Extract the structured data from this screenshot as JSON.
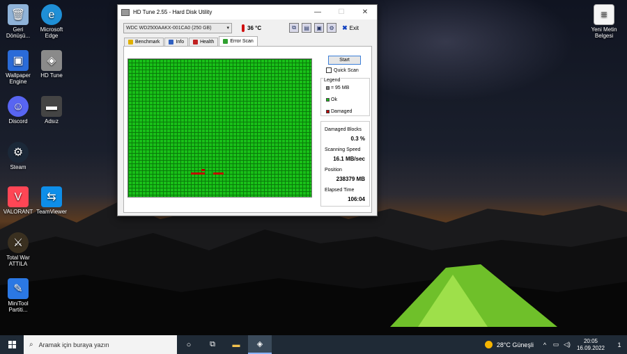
{
  "desktop": {
    "icons": [
      {
        "label": "Geri Dönüşü...",
        "color": "#8fb3d9"
      },
      {
        "label": "Microsoft Edge",
        "color": "#1f8fd6"
      },
      {
        "label": "Wallpaper Engine",
        "color": "#2a6bd8"
      },
      {
        "label": "HD Tune",
        "color": "#8a8a8a"
      },
      {
        "label": "Discord",
        "color": "#5865f2"
      },
      {
        "label": "Adsız",
        "color": "#444444"
      },
      {
        "label": "Steam",
        "color": "#1b2838"
      },
      {
        "label": "VALORANT",
        "color": "#ff4655"
      },
      {
        "label": "TeamViewer",
        "color": "#0e8ee9"
      },
      {
        "label": "Total War ATTILA",
        "color": "#3a3020"
      },
      {
        "label": "MiniTool Partiti...",
        "color": "#2b78e4"
      },
      {
        "label": "Yeni Metin Belgesi",
        "color": "#f5f5f5"
      }
    ]
  },
  "window": {
    "title": "HD Tune 2.55 - Hard Disk Utility",
    "drive": "WDC WD2500AAKX-001CA0 (250 GB)",
    "temperature": "36 °C",
    "exit_label": "Exit",
    "tabs": [
      {
        "label": "Benchmark",
        "color": "#e0b000"
      },
      {
        "label": "Info",
        "color": "#3060c0"
      },
      {
        "label": "Health",
        "color": "#c02020"
      },
      {
        "label": "Error Scan",
        "color": "#30a030"
      }
    ],
    "start_label": "Start",
    "quick_scan_label": "Quick Scan",
    "legend": {
      "title": "Legend",
      "block_size": "= 95 MB",
      "ok": "Ok",
      "damaged": "Damaged"
    },
    "stats": {
      "damaged_blocks_label": "Damaged Blocks",
      "damaged_blocks_value": "0.3 %",
      "scanning_speed_label": "Scanning Speed",
      "scanning_speed_value": "16.1 MB/sec",
      "position_label": "Position",
      "position_value": "238379 MB",
      "elapsed_label": "Elapsed Time",
      "elapsed_value": "106:04"
    }
  },
  "taskbar": {
    "search_placeholder": "Aramak için buraya yazın",
    "weather": "28°C  Güneşli",
    "time": "20:05",
    "date": "16.09.2022",
    "notifications": "1"
  }
}
